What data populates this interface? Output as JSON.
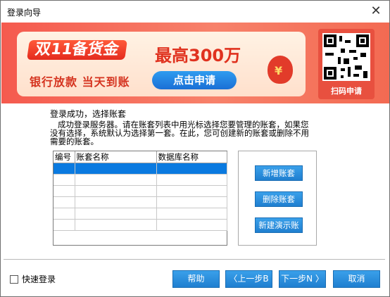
{
  "window": {
    "title": "登录向导",
    "close_glyph": "✕"
  },
  "banner": {
    "tag": "双11备货金",
    "amount": "最高300万",
    "slogan": "银行放款 当天到账",
    "apply_label": "点击申请",
    "qr_label": "扫码申请"
  },
  "content": {
    "heading": "登录成功，选择账套",
    "description": "成功登录服务器。请在账套列表中用光标选择您要管理的账套，如果您没有选择，系统默认为选择第一套。在此，您可创建新的账套或删除不用需要的账套。"
  },
  "table": {
    "columns": [
      "编号",
      "账套名称",
      "数据库名称"
    ],
    "rows": [
      [
        "",
        "",
        ""
      ],
      [
        "",
        "",
        ""
      ],
      [
        "",
        "",
        ""
      ],
      [
        "",
        "",
        ""
      ],
      [
        "",
        "",
        ""
      ],
      [
        "",
        "",
        ""
      ]
    ]
  },
  "side_buttons": {
    "add": "新增账套",
    "delete": "删除账套",
    "demo": "新建演示账套"
  },
  "footer": {
    "quick_login": "快速登录",
    "help": "帮助",
    "prev": "〈上一步B",
    "next": "下一步N 〉",
    "cancel": "取消"
  },
  "colors": {
    "accent": "#1f7fd0",
    "selection": "#0a7ae0",
    "banner": "#f55a4e"
  }
}
